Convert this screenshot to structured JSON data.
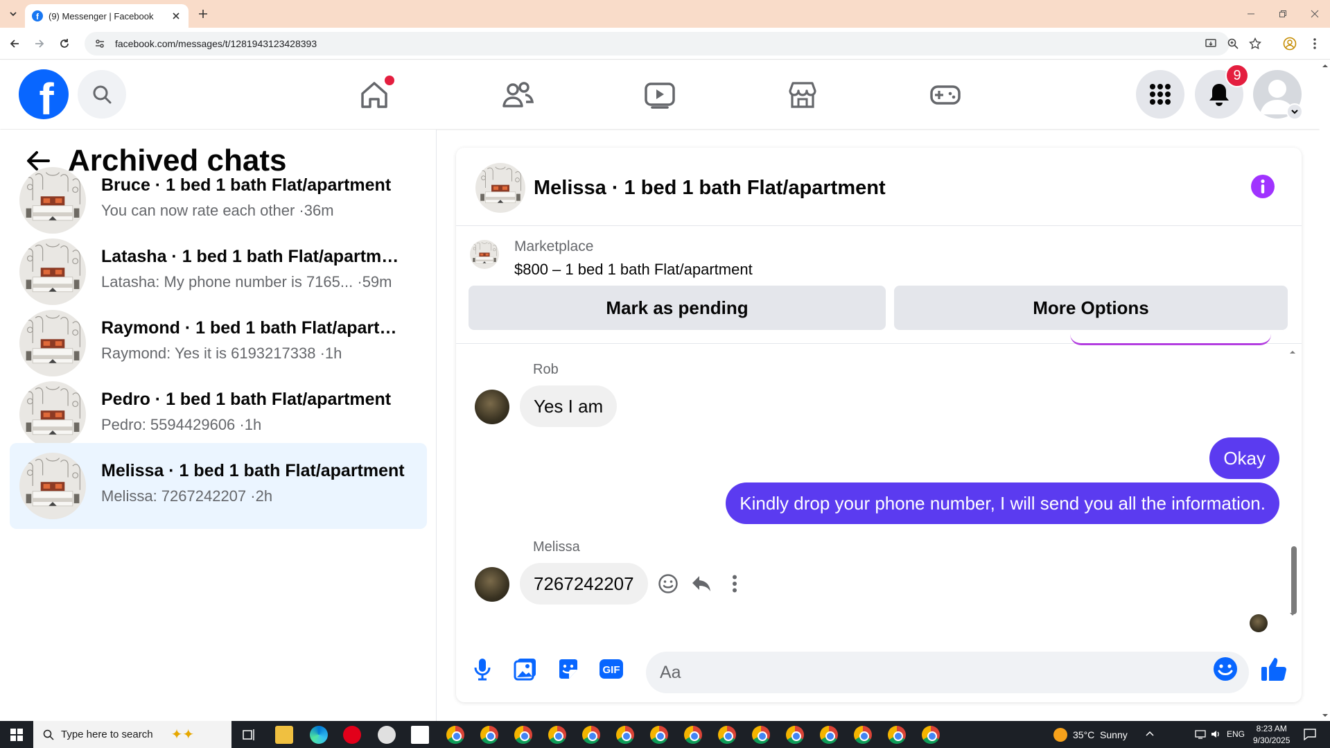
{
  "browser": {
    "tab_title": "(9) Messenger | Facebook",
    "url": "facebook.com/messages/t/1281943123428393"
  },
  "header": {
    "notification_count": "9"
  },
  "archived": {
    "title": "Archived chats",
    "chats": [
      {
        "name": "Bruce · 1 bed 1 bath Flat/apartment",
        "message": "You can now rate each other",
        "time": "36m",
        "selected": false
      },
      {
        "name": "Latasha · 1 bed 1 bath Flat/apartment",
        "message": "Latasha: My phone number is 7165...",
        "time": "59m",
        "selected": false
      },
      {
        "name": "Raymond · 1 bed 1 bath Flat/apartment",
        "message": "Raymond: Yes it is 6193217338",
        "time": "1h",
        "selected": false
      },
      {
        "name": "Pedro · 1 bed 1 bath Flat/apartment",
        "message": "Pedro: 5594429606",
        "time": "1h",
        "selected": false
      },
      {
        "name": "Melissa · 1 bed 1 bath Flat/apartment",
        "message": "Melissa: 7267242207",
        "time": "2h",
        "selected": true
      }
    ]
  },
  "conversation": {
    "title": "Melissa · 1 bed 1 bath Flat/apartment",
    "marketplace": {
      "label": "Marketplace",
      "listing": "$800 – 1 bed 1 bath Flat/apartment",
      "mark_pending": "Mark as pending",
      "more_options": "More Options"
    },
    "messages": {
      "rob_name": "Rob",
      "rob_text": "Yes I am",
      "out_1": "Okay",
      "out_2": "Kindly drop your phone number, I will send you all the information.",
      "melissa_name": "Melissa",
      "melissa_text": "7267242207"
    },
    "composer_placeholder": "Aa"
  },
  "taskbar": {
    "search_placeholder": "Type here to search",
    "weather": "35°C  Sunny",
    "lang": "ENG",
    "time": "8:23 AM",
    "date": "9/30/2025"
  },
  "colors": {
    "fb_blue": "#0866ff",
    "outgoing_bubble": "#5b3bf0",
    "selected_chat": "#ebf5ff",
    "badge_red": "#e41e3f"
  }
}
